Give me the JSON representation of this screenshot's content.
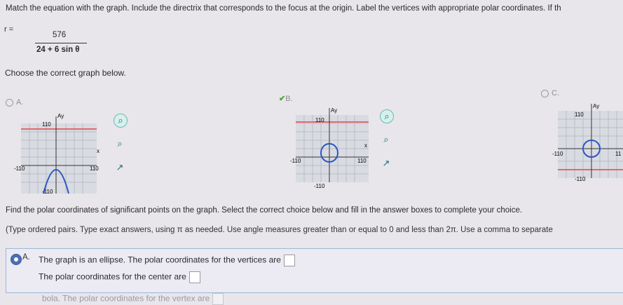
{
  "instruction": "Match the equation with the graph. Include the directrix that corresponds to the focus at the origin. Label the vertices with appropriate polar coordinates. If th",
  "equation": {
    "lhs": "r =",
    "numerator": "576",
    "denominator": "24 + 6 sin θ"
  },
  "choose_prompt": "Choose the correct graph below.",
  "options": [
    {
      "label": "A.",
      "tick_pos": "110",
      "tick_neg": "-110",
      "tick_top": "110",
      "tick_bot": "-110",
      "xlabel": "x",
      "ylabel": "Ay"
    },
    {
      "label": "B.",
      "tick_pos": "110",
      "tick_neg": "-110",
      "tick_top": "110",
      "tick_bot": "-110",
      "xlabel": "x",
      "ylabel": "Ay"
    },
    {
      "label": "C.",
      "tick_pos": "11",
      "tick_neg": "-110",
      "tick_top": "110",
      "tick_bot": "-110",
      "xlabel": "",
      "ylabel": "Ay"
    }
  ],
  "find_text": "Find the polar coordinates of significant points on the graph. Select the correct choice below and fill in the answer boxes to complete your choice.",
  "tip_text": "(Type ordered pairs. Type exact answers, using π as needed. Use angle measures greater than or equal to 0 and less than 2π. Use a comma to separate",
  "answer": {
    "label": "A.",
    "line1": "The graph is an ellipse. The polar coordinates for the vertices are",
    "line2": "The polar coordinates for the center are"
  },
  "faded_text": "bola. The polar coordinates for the vertex are"
}
